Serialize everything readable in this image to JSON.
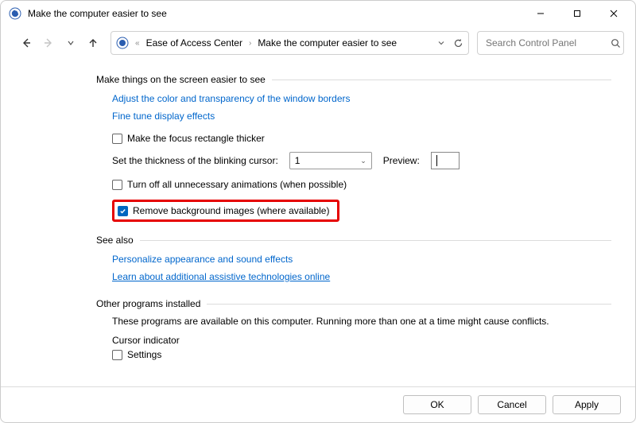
{
  "window": {
    "title": "Make the computer easier to see"
  },
  "breadcrumb": {
    "item1": "Ease of Access Center",
    "item2": "Make the computer easier to see"
  },
  "search": {
    "placeholder": "Search Control Panel"
  },
  "sections": {
    "make_easier": {
      "heading": "Make things on the screen easier to see",
      "link_adjust": "Adjust the color and transparency of the window borders",
      "link_fine_tune": "Fine tune display effects",
      "chk_focus": "Make the focus rectangle thicker",
      "thickness_label": "Set the thickness of the blinking cursor:",
      "thickness_value": "1",
      "preview_label": "Preview:",
      "chk_animations": "Turn off all unnecessary animations (when possible)",
      "chk_remove_bg": "Remove background images (where available)"
    },
    "see_also": {
      "heading": "See also",
      "link_personalize": "Personalize appearance and sound effects",
      "link_assistive": "Learn about additional assistive technologies online"
    },
    "other": {
      "heading": "Other programs installed",
      "desc": "These programs are available on this computer. Running more than one at a time might cause conflicts.",
      "cursor_indicator": "Cursor indicator",
      "chk_settings": "Settings"
    }
  },
  "buttons": {
    "ok": "OK",
    "cancel": "Cancel",
    "apply": "Apply"
  }
}
